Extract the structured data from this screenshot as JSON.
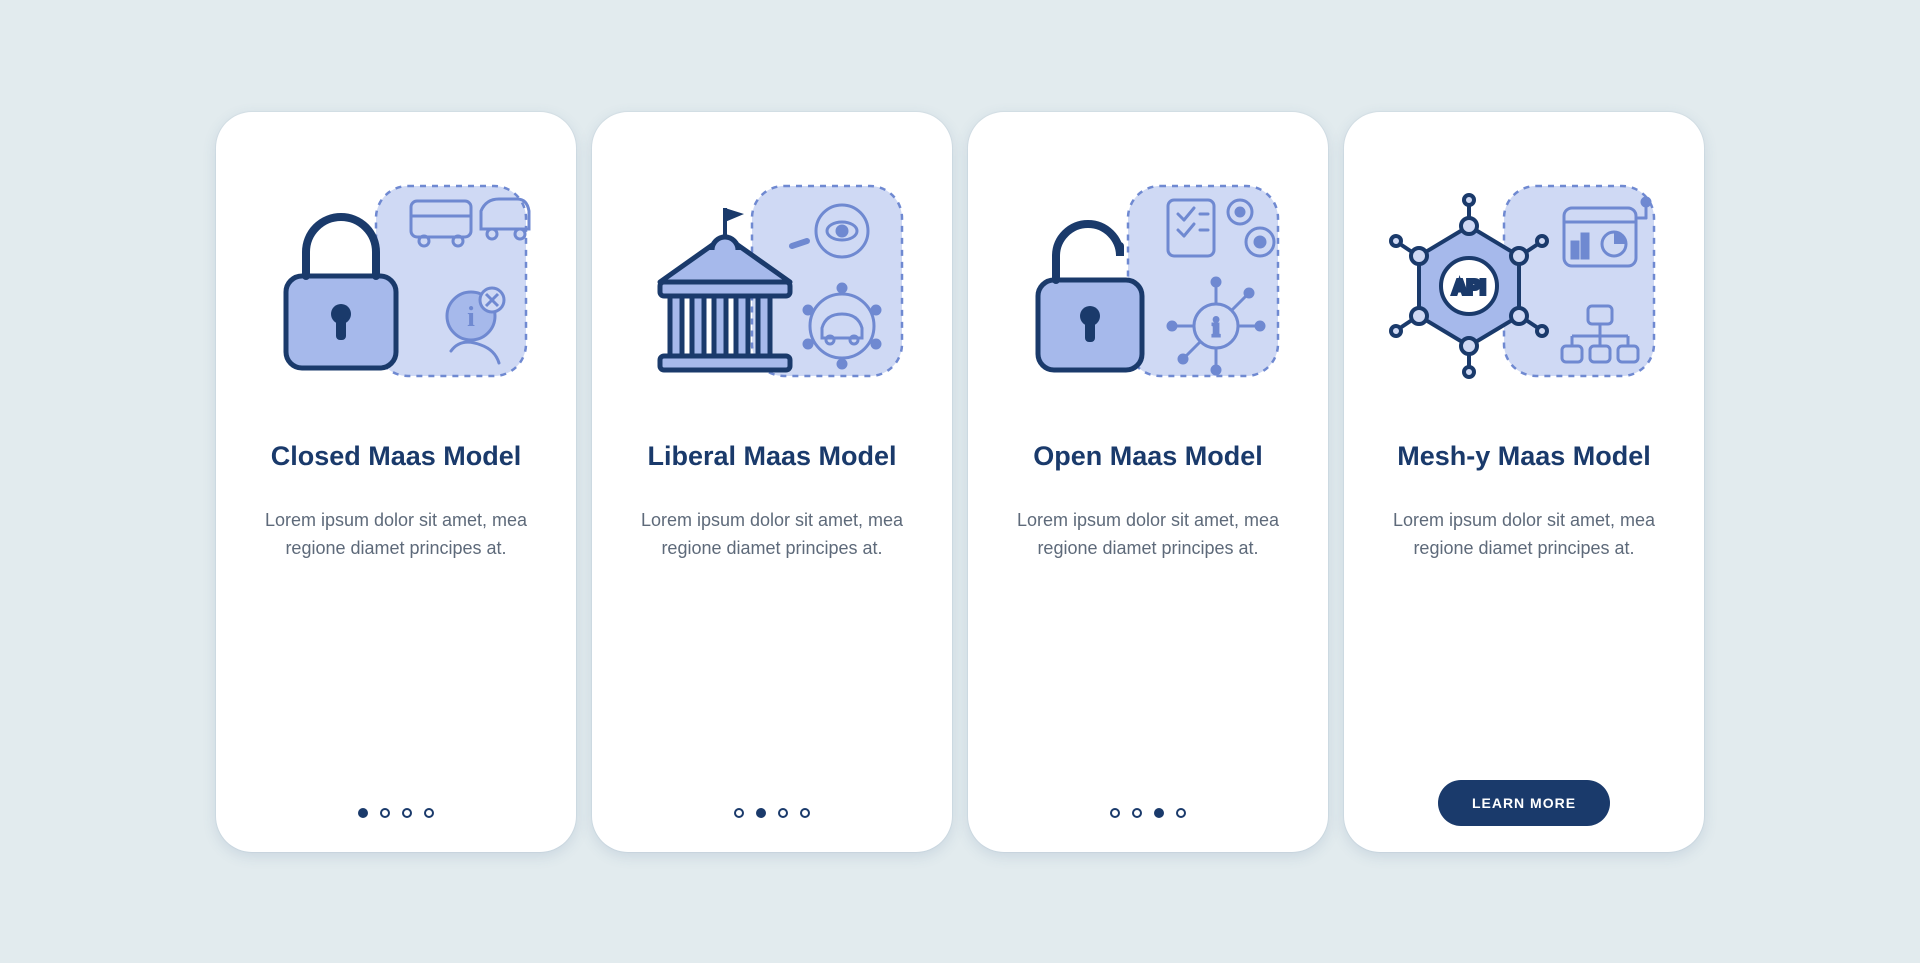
{
  "colors": {
    "primary": "#1a3a6b",
    "icon_stroke": "#6f89d1",
    "icon_fill_light": "#cfd9f4",
    "icon_fill_mid": "#a6b9eb",
    "bg": "#e2ebee",
    "card": "#ffffff",
    "body_text": "#5e6a7a"
  },
  "cards": [
    {
      "id": "closed",
      "title": "Closed Maas Model",
      "body": "Lorem ipsum dolor sit amet, mea regione diamet principes at.",
      "icon_name": "lock-closed-icon",
      "active_dot": 0,
      "has_cta": false
    },
    {
      "id": "liberal",
      "title": "Liberal Maas Model",
      "body": "Lorem ipsum dolor sit amet, mea regione diamet principes at.",
      "icon_name": "government-building-icon",
      "active_dot": 1,
      "has_cta": false
    },
    {
      "id": "open",
      "title": "Open Maas Model",
      "body": "Lorem ipsum dolor sit amet, mea regione diamet principes at.",
      "icon_name": "lock-open-icon",
      "active_dot": 2,
      "has_cta": false
    },
    {
      "id": "mesh",
      "title": "Mesh-y Maas Model",
      "body": "Lorem ipsum dolor sit amet, mea regione diamet principes at.",
      "icon_name": "api-mesh-icon",
      "active_dot": 3,
      "has_cta": true
    }
  ],
  "cta_label": "LEARN MORE",
  "dot_count": 4
}
